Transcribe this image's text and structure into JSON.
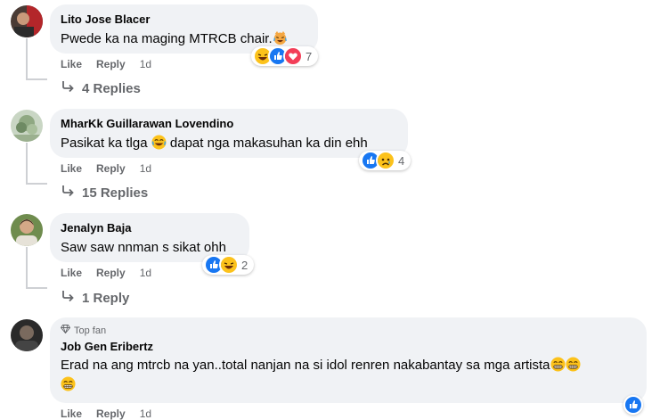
{
  "comments": [
    {
      "author": "Lito Jose Blacer",
      "text": "Pwede ka na maging MTRCB chair.",
      "like": "Like",
      "reply": "Reply",
      "time": "1d",
      "reaction_count": "7",
      "replies": "4 Replies"
    },
    {
      "author": "MharKk Guillarawan Lovendino",
      "text_before": "Pasikat ka tlga",
      "text_after": "dapat nga makasuhan ka din ehh",
      "like": "Like",
      "reply": "Reply",
      "time": "1d",
      "reaction_count": "4",
      "replies": "15 Replies"
    },
    {
      "author": "Jenalyn Baja",
      "text": "Saw saw nnman s sikat ohh",
      "like": "Like",
      "reply": "Reply",
      "time": "1d",
      "reaction_count": "2",
      "replies": "1 Reply"
    },
    {
      "badge": "Top fan",
      "author": "Job Gen Eribertz",
      "text": "Erad na ang mtrcb na yan..total nanjan na si idol renren nakabantay sa mga artista",
      "like": "Like",
      "reply": "Reply",
      "time": "1d"
    }
  ],
  "colors": {
    "bubble": "#f0f2f5",
    "secondary_text": "#65676b",
    "like_blue": "#1877f2",
    "love_red": "#f33e58",
    "emoji_yellow": "#fcc21b"
  },
  "icons": [
    "reply-arrow-icon",
    "like-reaction-icon",
    "haha-reaction-icon",
    "love-reaction-icon",
    "sad-reaction-icon",
    "diamond-icon"
  ]
}
